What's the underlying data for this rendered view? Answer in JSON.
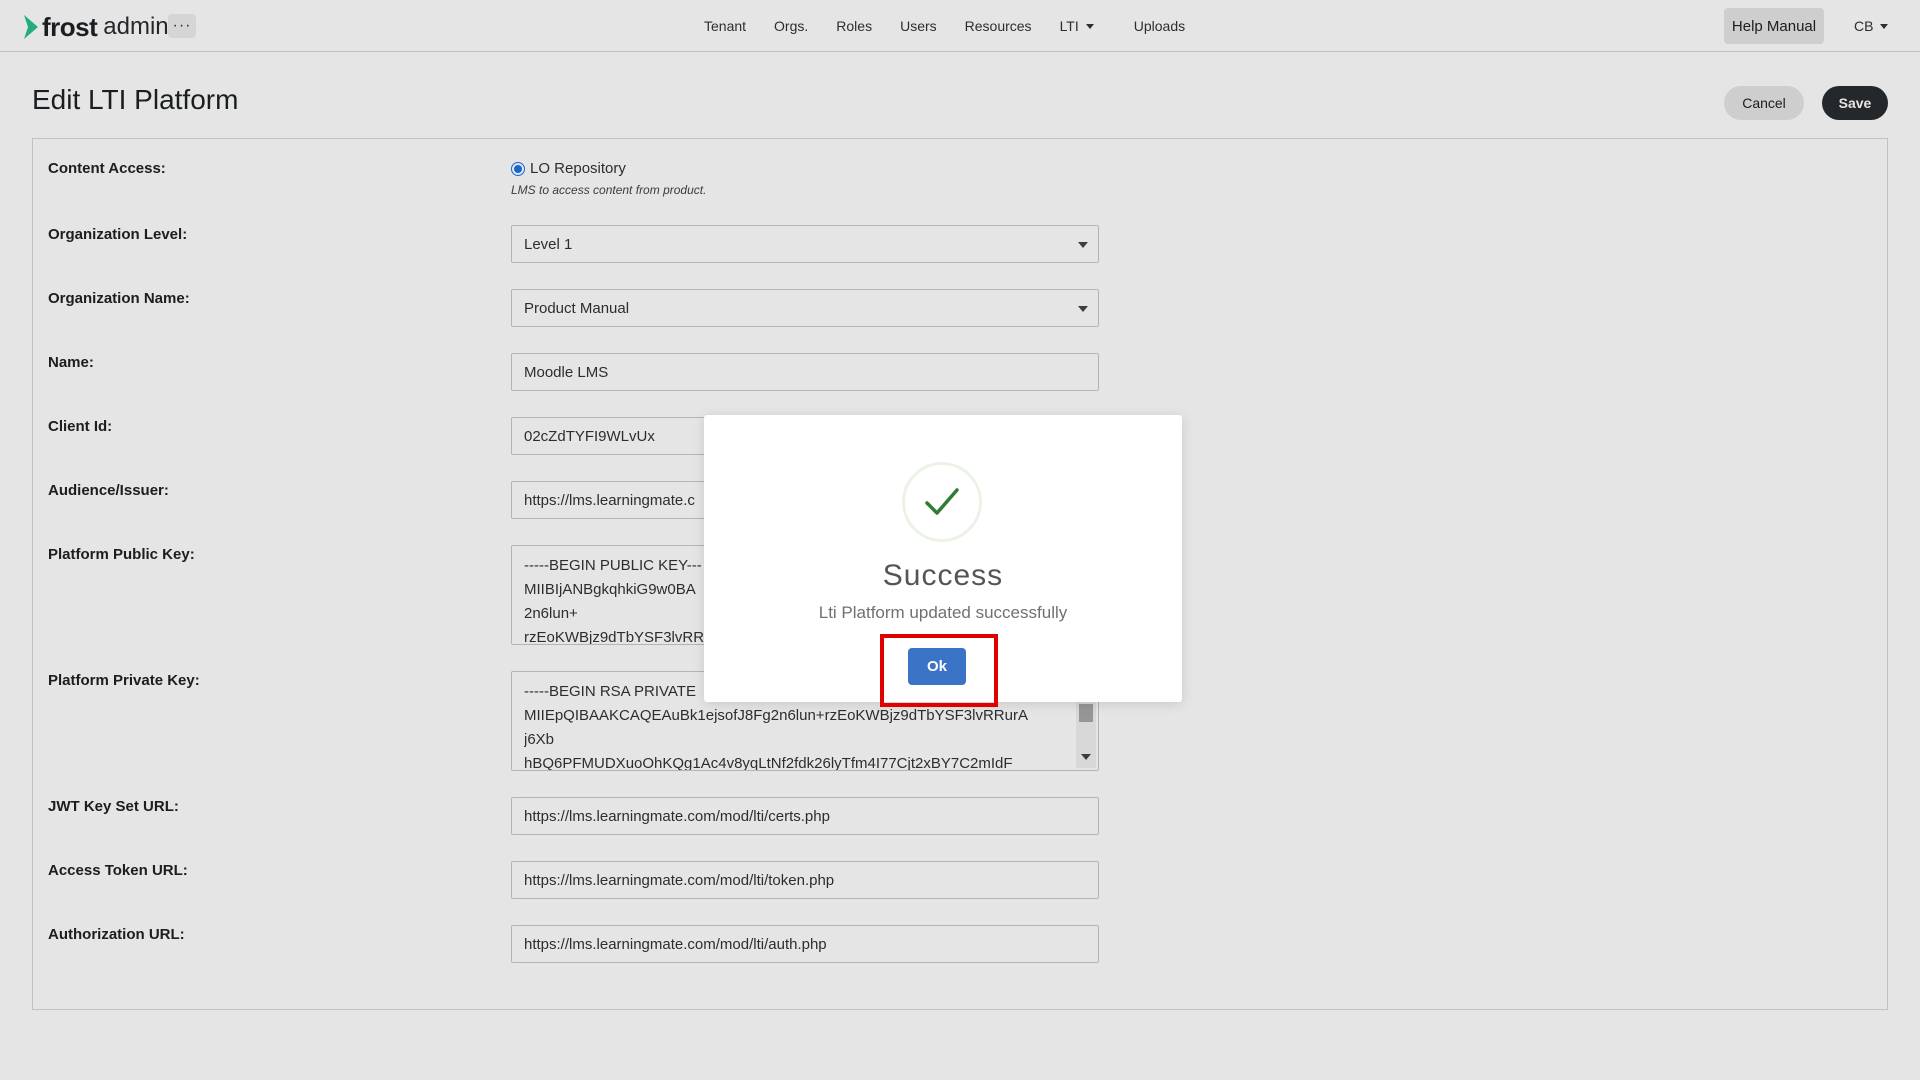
{
  "brand": {
    "name_bold": "frost",
    "name_light": "admin"
  },
  "nav": {
    "more_label": "···",
    "links": [
      "Tenant",
      "Orgs.",
      "Roles",
      "Users",
      "Resources",
      "LTI",
      "Uploads"
    ],
    "help_label": "Help Manual",
    "user_initials": "CB"
  },
  "page": {
    "title": "Edit LTI Platform",
    "cancel_label": "Cancel",
    "save_label": "Save"
  },
  "form": {
    "content_access": {
      "label": "Content Access:",
      "option": "LO Repository",
      "help": "LMS to access content from product."
    },
    "org_level": {
      "label": "Organization Level:",
      "value": "Level 1"
    },
    "org_name": {
      "label": "Organization Name:",
      "value": "Product Manual"
    },
    "name": {
      "label": "Name:",
      "value": "Moodle LMS"
    },
    "client_id": {
      "label": "Client Id:",
      "value": "02cZdTYFI9WLvUx"
    },
    "audience": {
      "label": "Audience/Issuer:",
      "value": "https://lms.learningmate.c"
    },
    "public_key": {
      "label": "Platform Public Key:",
      "lines": [
        "-----BEGIN PUBLIC KEY---",
        "MIIBIjANBgkqhkiG9w0BA",
        "2n6lun+",
        "rzEoKWBjz9dTbYSF3lvRR"
      ]
    },
    "private_key": {
      "label": "Platform Private Key:",
      "lines": [
        "-----BEGIN RSA PRIVATE",
        "MIIEpQIBAAKCAQEAuBk1ejsofJ8Fg2n6lun+rzEoKWBjz9dTbYSF3lvRRurA",
        "j6Xb",
        "hBQ6PFMUDXuoOhKQg1Ac4v8yqLtNf2fdk26lyTfm4I77Cjt2xBY7C2mIdF"
      ]
    },
    "jwt_url": {
      "label": "JWT Key Set URL:",
      "value": "https://lms.learningmate.com/mod/lti/certs.php"
    },
    "token_url": {
      "label": "Access Token URL:",
      "value": "https://lms.learningmate.com/mod/lti/token.php"
    },
    "auth_url": {
      "label": "Authorization URL:",
      "value": "https://lms.learningmate.com/mod/lti/auth.php"
    }
  },
  "modal": {
    "title": "Success",
    "message": "Lti Platform updated successfully",
    "ok_label": "Ok"
  },
  "colors": {
    "primary_button": "#3b73c6",
    "dark_button": "#2a2d30",
    "success_check": "#2e7d32",
    "highlight": "#e00000",
    "radio": "#1a73e8"
  }
}
